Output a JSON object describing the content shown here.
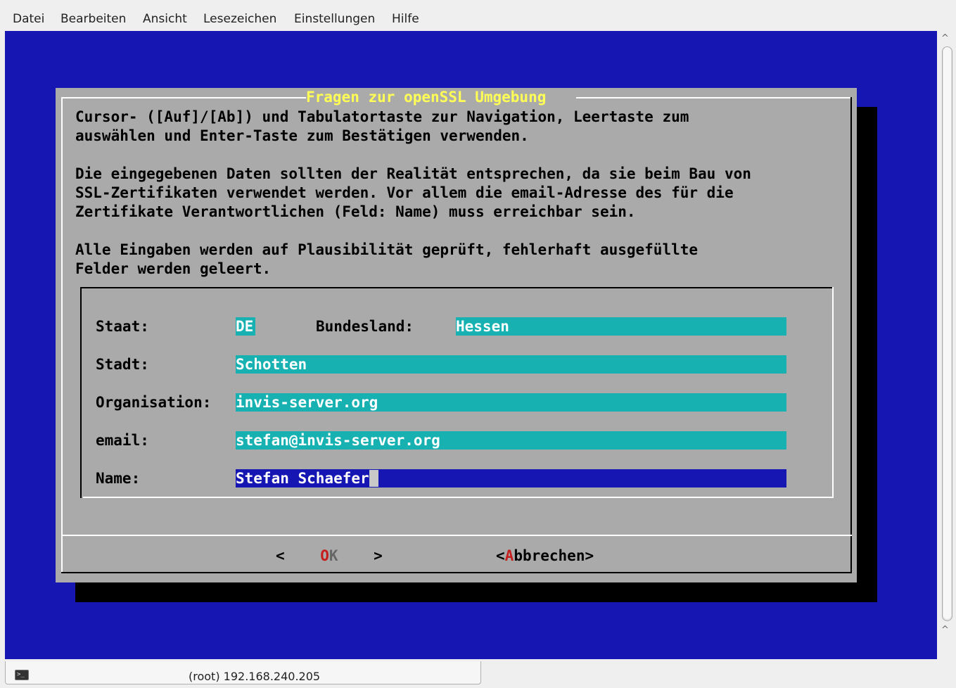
{
  "menu": [
    "Datei",
    "Bearbeiten",
    "Ansicht",
    "Lesezeichen",
    "Einstellungen",
    "Hilfe"
  ],
  "dialog": {
    "title": "Fragen zur openSSL Umgebung",
    "lines": [
      "Cursor- ([Auf]/[Ab]) und Tabulatortaste zur Navigation, Leertaste zum",
      "auswählen und Enter-Taste zum Bestätigen verwenden.",
      "Die eingegebenen Daten sollten der Realität entsprechen, da sie beim Bau von",
      "SSL-Zertifikaten verwendet werden. Vor allem die email-Adresse des für die",
      "Zertifikate Verantwortlichen (Feld: Name) muss erreichbar sein.",
      "Alle Eingaben werden auf Plausibilität geprüft, fehlerhaft ausgefüllte",
      "Felder werden geleert."
    ],
    "form": {
      "staat_label": "Staat:",
      "staat_value": "DE",
      "bundesland_label": "Bundesland:",
      "bundesland_value": "Hessen",
      "stadt_label": "Stadt:",
      "stadt_value": "Schotten",
      "organisation_label": "Organisation:",
      "organisation_value": "invis-server.org",
      "email_label": "email:",
      "email_value": "stefan@invis-server.org",
      "name_label": "Name:",
      "name_value": "Stefan Schaefer"
    },
    "buttons": {
      "ok": {
        "left": "<",
        "hot": "O",
        "rest": "K",
        "right": ">"
      },
      "cancel": {
        "left": "<",
        "hot": "A",
        "rest": "bbrechen",
        "right": ">"
      }
    }
  },
  "status": {
    "tab_title": "(root) 192.168.240.205",
    "tab_icon": "terminal-icon"
  },
  "colors": {
    "terminal_bg": "#1616b3",
    "dialog_bg": "#aaaaaa",
    "field_bg": "#17b1b1",
    "title_color": "#ffff55",
    "hotkey_color": "#c51c1c"
  }
}
